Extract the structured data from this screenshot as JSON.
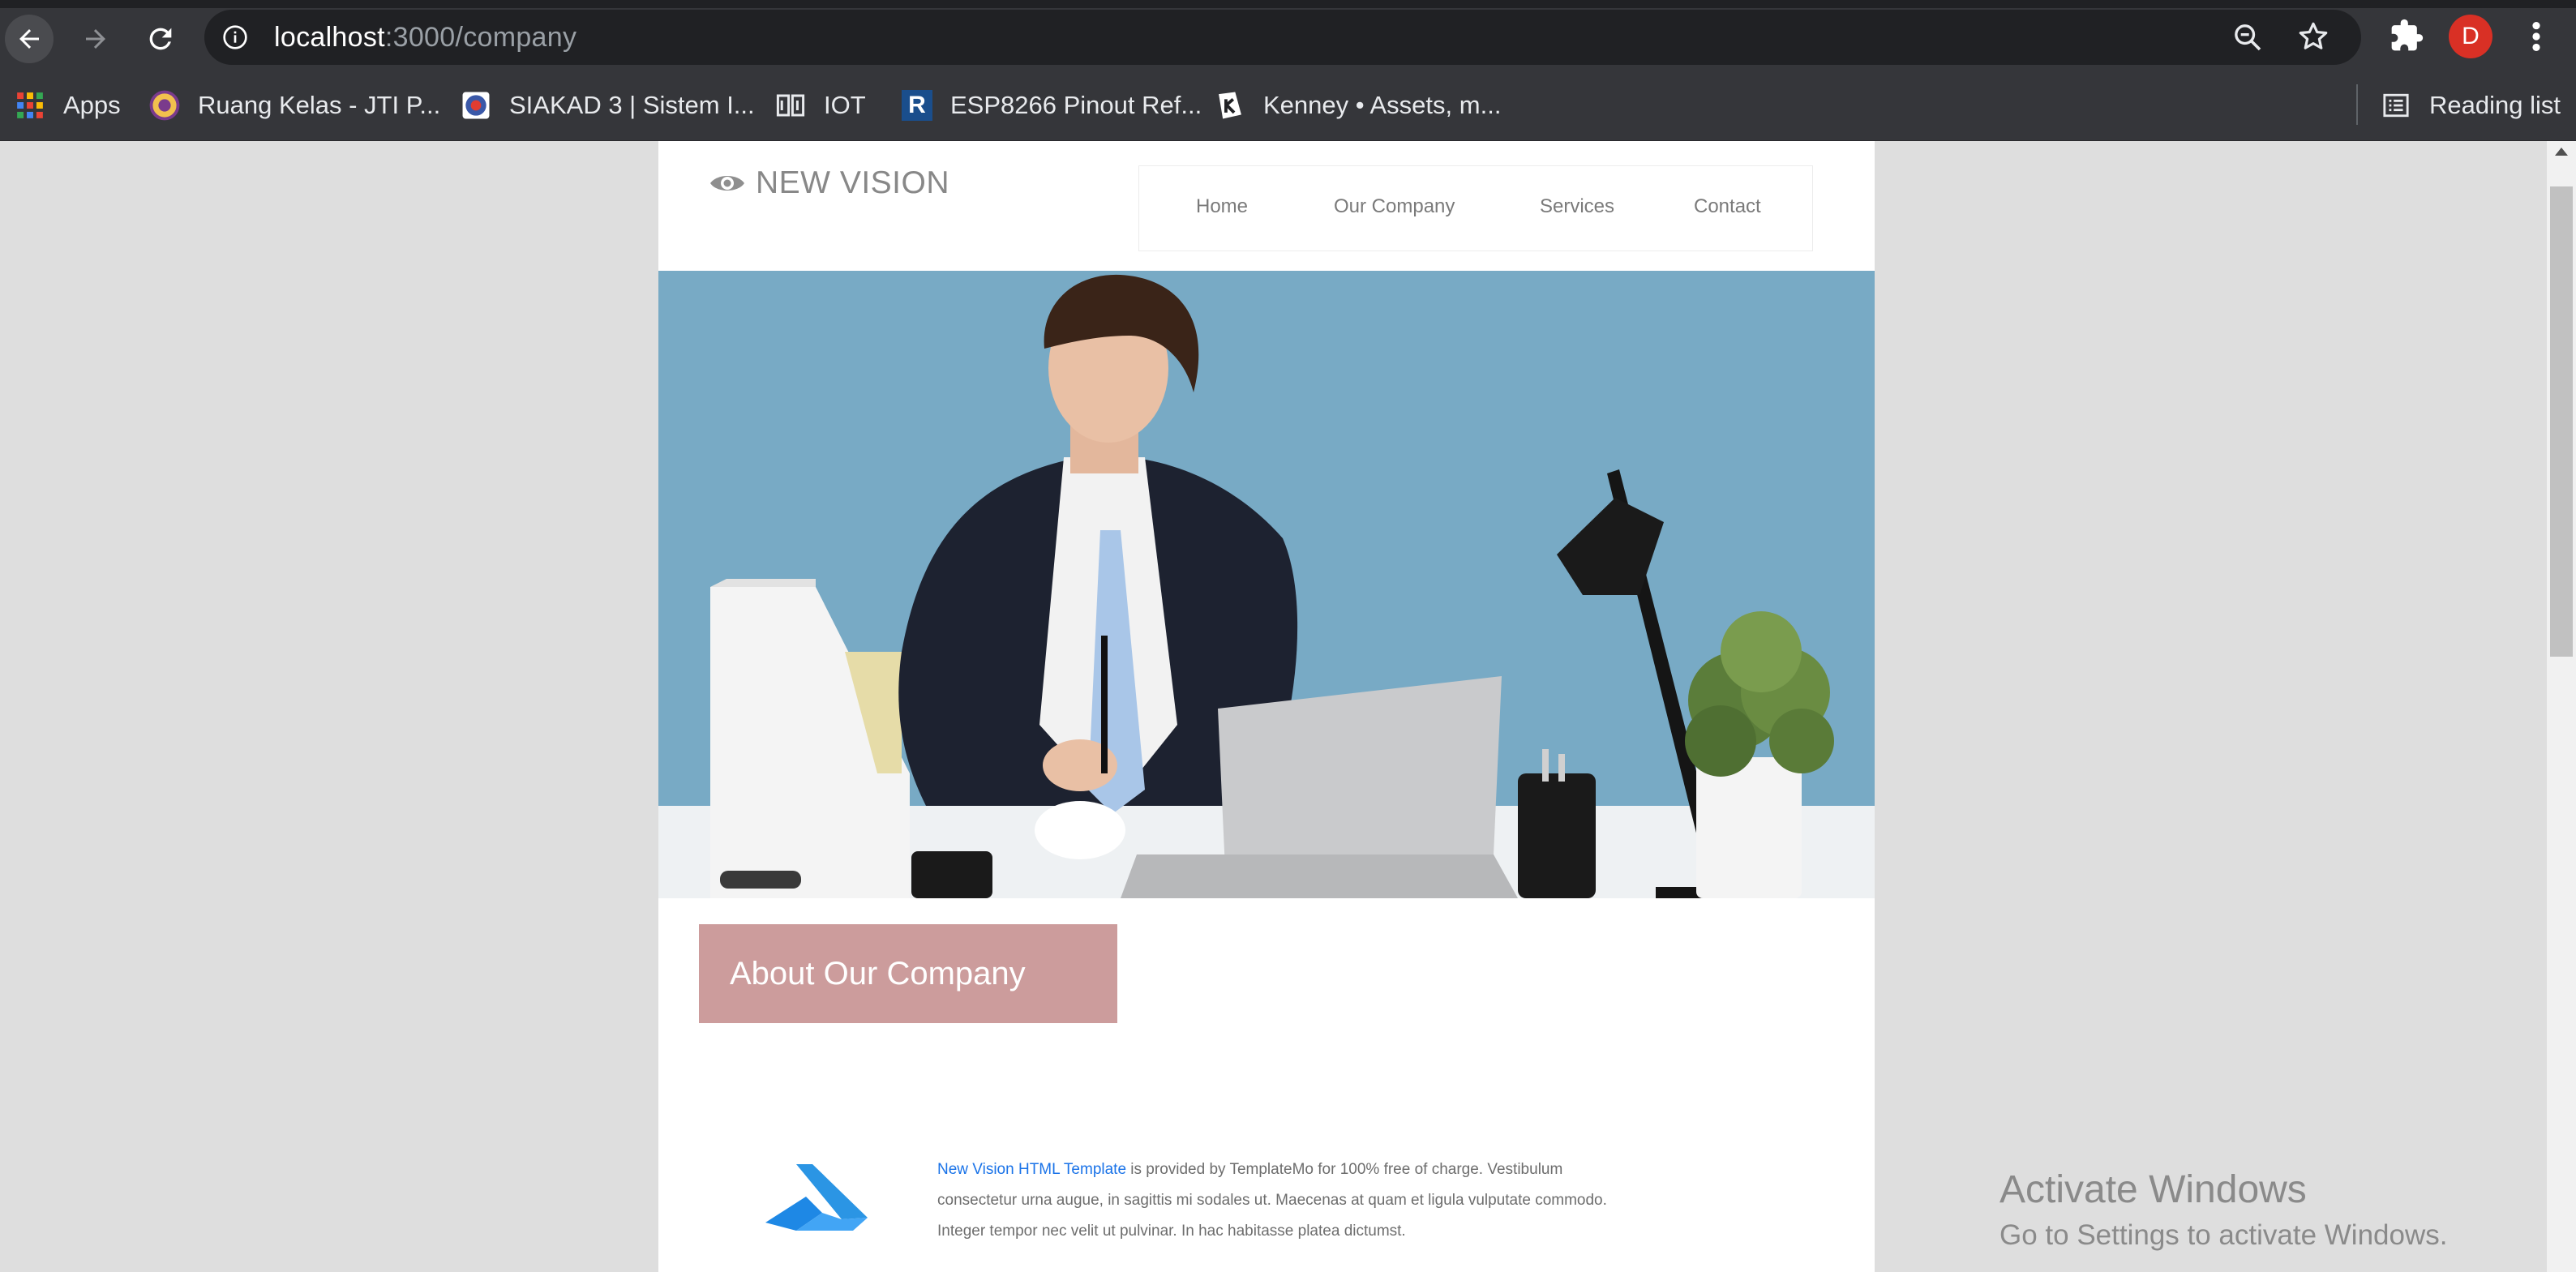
{
  "browser": {
    "url_host": "localhost",
    "url_path": ":3000/company",
    "profile_initial": "D",
    "reading_list_label": "Reading list",
    "bookmarks": [
      {
        "label": "Apps",
        "icon": "apps-grid-icon"
      },
      {
        "label": "Ruang Kelas - JTI P...",
        "icon": "campus-crest-icon"
      },
      {
        "label": "SIAKAD 3 | Sistem I...",
        "icon": "siakad-crest-icon"
      },
      {
        "label": "IOT",
        "icon": "iot-icon"
      },
      {
        "label": "ESP8266 Pinout Ref...",
        "icon": "r-logo-icon"
      },
      {
        "label": "Kenney • Assets, m...",
        "icon": "kenney-logo-icon"
      }
    ],
    "colors": {
      "toolbar": "#35363a",
      "omnibox": "#202124",
      "avatar": "#d93025"
    }
  },
  "site": {
    "brand": "NEW VISION",
    "nav": [
      {
        "label": "Home"
      },
      {
        "label": "Our Company"
      },
      {
        "label": "Services"
      },
      {
        "label": "Contact"
      }
    ],
    "hero_image": "businessman-at-desk-photo",
    "about_title": "About Our Company",
    "feature": {
      "link_text": "New Vision HTML Template",
      "line1_rest": " is provided by TemplateMo for 100% free of charge. Vestibulum",
      "line2": "consectetur urna augue, in sagittis mi sodales ut. Maecenas at quam et ligula vulputate commodo.",
      "line3": "Integer tempor nec velit ut pulvinar. In hac habitasse platea dictumst.",
      "icon": "feature-logo-icon"
    },
    "colors": {
      "about_banner": "#cc9c9c",
      "link": "#1a73e8",
      "hero_bg": "#78aac5"
    }
  },
  "os_watermark": {
    "line1": "Activate Windows",
    "line2": "Go to Settings to activate Windows."
  }
}
